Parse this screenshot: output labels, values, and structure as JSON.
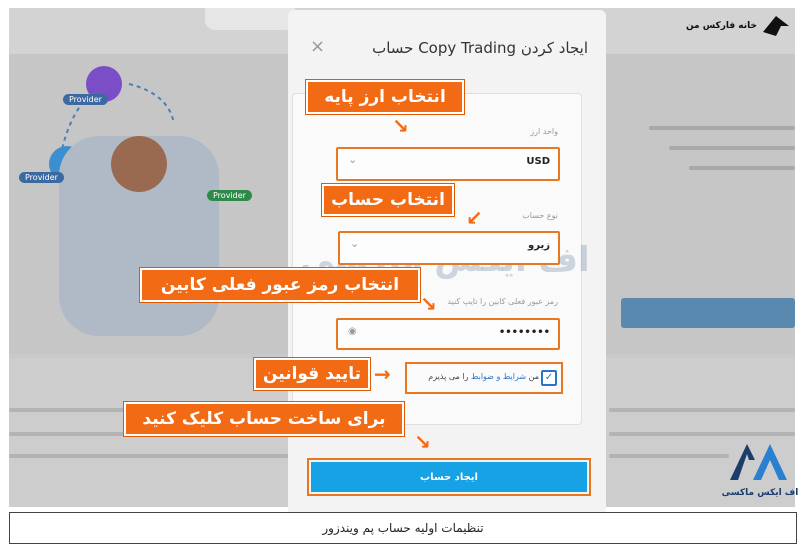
{
  "site": {
    "logo_text": "خانه فارکس من",
    "watermark": "اف ایکس ماکسی",
    "bottom_logo_text": "اف ایکس ماکسی"
  },
  "hero": {
    "badges": [
      "Provider",
      "Provider",
      "Provider"
    ]
  },
  "modal": {
    "title": "ایجاد کردن Copy Trading حساب",
    "close_icon": "×",
    "base_currency_label": "واحد ارز",
    "base_currency_value": "USD",
    "account_type_label": "نوع حساب",
    "account_type_value": "زیرو",
    "password_label": "رمز عبور فعلی کابین را تایپ کنید",
    "password_value": "••••••••",
    "terms_prefix": "من",
    "terms_link": "شرایط و ضوابط",
    "terms_suffix": "را می پذیرم",
    "submit_label": "ایجاد حساب"
  },
  "annotations": {
    "select_currency": "انتخاب ارز پایه",
    "select_account": "انتخاب حساب",
    "enter_password": "انتخاب رمز عبور فعلی کابین",
    "accept_terms": "تایید قوانین",
    "click_create": "برای ساخت حساب کلیک کنید"
  },
  "caption": "تنظیمات اولیه حساب پم ویندزور",
  "colors": {
    "annotation": "#f26a14",
    "submit": "#17a2e6",
    "link": "#2b73c9"
  }
}
